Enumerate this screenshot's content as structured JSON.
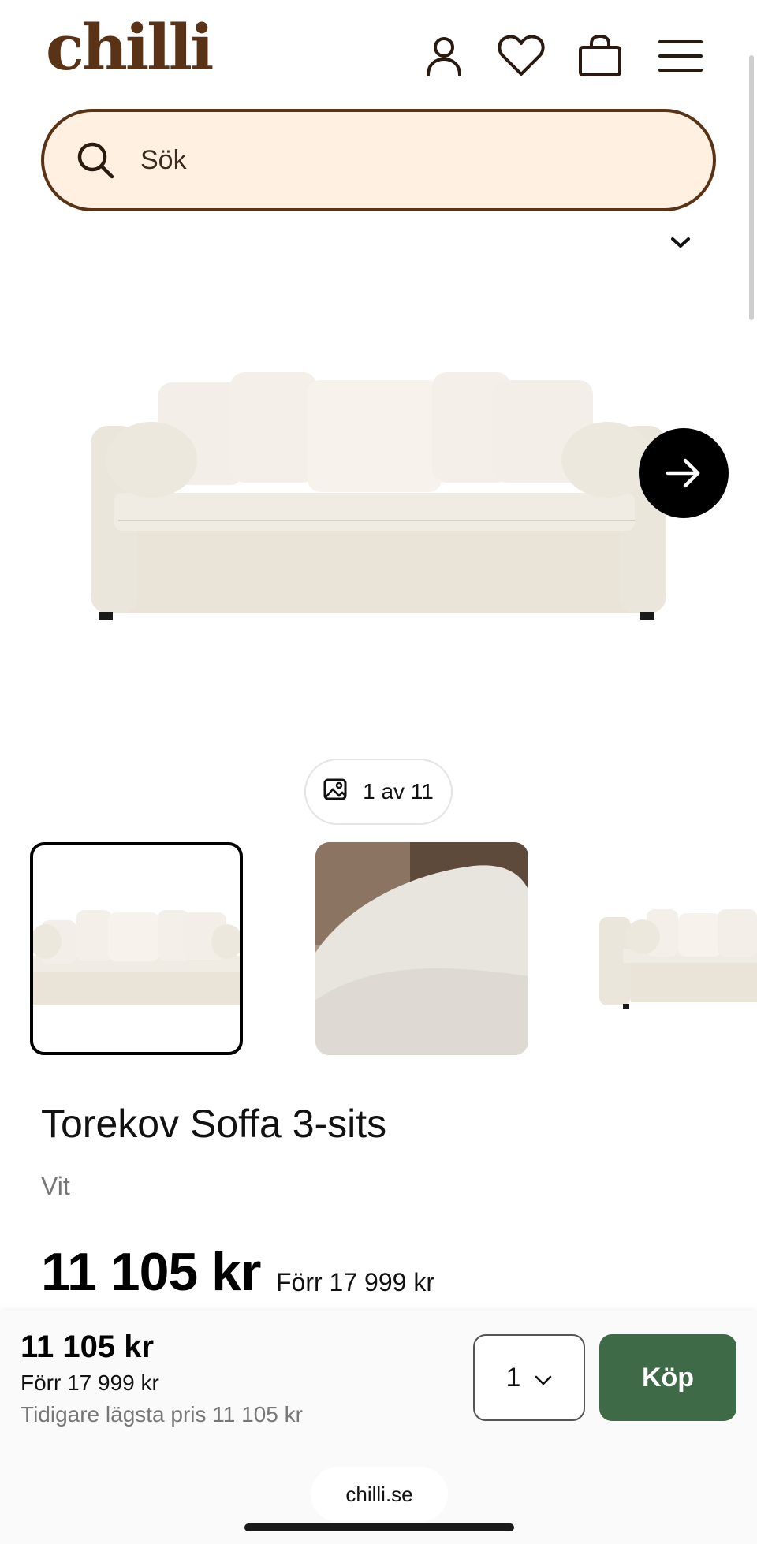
{
  "header": {
    "logo": "chilli",
    "icons": [
      "user-icon",
      "heart-icon",
      "shopping-bag-icon",
      "menu-icon"
    ]
  },
  "search": {
    "placeholder": "Sök"
  },
  "gallery": {
    "counter": "1 av 11"
  },
  "product": {
    "title": "Torekov Soffa 3-sits",
    "variant": "Vit",
    "price": "11 105 kr",
    "before_price": "Förr 17 999 kr"
  },
  "sticky_bar": {
    "price": "11 105 kr",
    "before_price": "Förr 17 999 kr",
    "lowest_price": "Tidigare lägsta pris 11 105 kr",
    "quantity": "1",
    "buy_label": "Köp"
  },
  "browser": {
    "url": "chilli.se"
  },
  "colors": {
    "brand_brown": "#5a3316",
    "search_bg": "#fff0e1",
    "buy_green": "#3f6a47"
  }
}
